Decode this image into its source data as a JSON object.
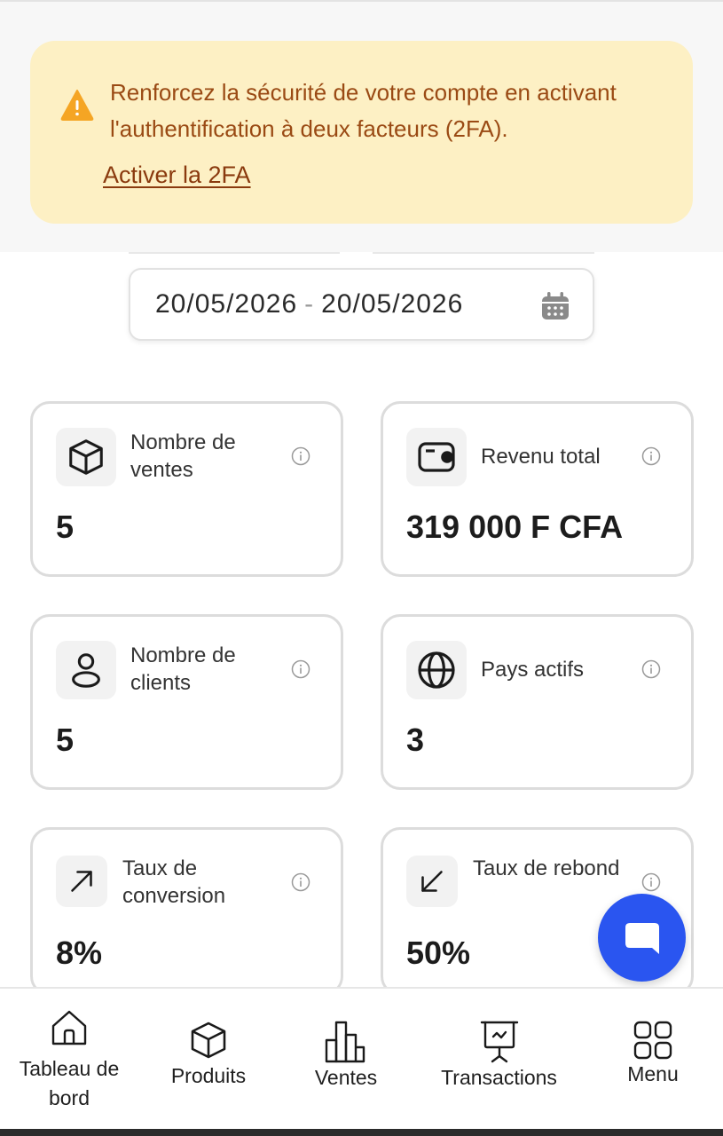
{
  "alert": {
    "message": "Renforcez la sécurité de votre compte en activant l'authentification à deux facteurs (2FA).",
    "link": "Activer la 2FA",
    "icon": "warning-icon",
    "color": "#f5a524"
  },
  "date_range": {
    "start": "20/05/2026",
    "separator": "-",
    "end": "20/05/2026",
    "icon": "calendar-icon"
  },
  "stats": [
    {
      "label": "Nombre de ventes",
      "value": "5",
      "icon": "package-icon"
    },
    {
      "label": "Revenu total",
      "value": "319 000 F CFA",
      "icon": "wallet-icon"
    },
    {
      "label": "Nombre de clients",
      "value": "5",
      "icon": "user-icon"
    },
    {
      "label": "Pays actifs",
      "value": "3",
      "icon": "globe-icon"
    },
    {
      "label": "Taux de conversion",
      "value": "8%",
      "icon": "arrow-up-right-icon"
    },
    {
      "label": "Taux de rebond",
      "value": "50%",
      "icon": "arrow-down-left-icon"
    }
  ],
  "chat": {
    "icon": "chat-icon",
    "color": "#2a55f0"
  },
  "nav": [
    {
      "label": "Tableau de bord",
      "icon": "home-icon"
    },
    {
      "label": "Produits",
      "icon": "package-icon"
    },
    {
      "label": "Ventes",
      "icon": "bar-chart-icon"
    },
    {
      "label": "Transactions",
      "icon": "presentation-icon"
    },
    {
      "label": "Menu",
      "icon": "grid-icon"
    }
  ]
}
